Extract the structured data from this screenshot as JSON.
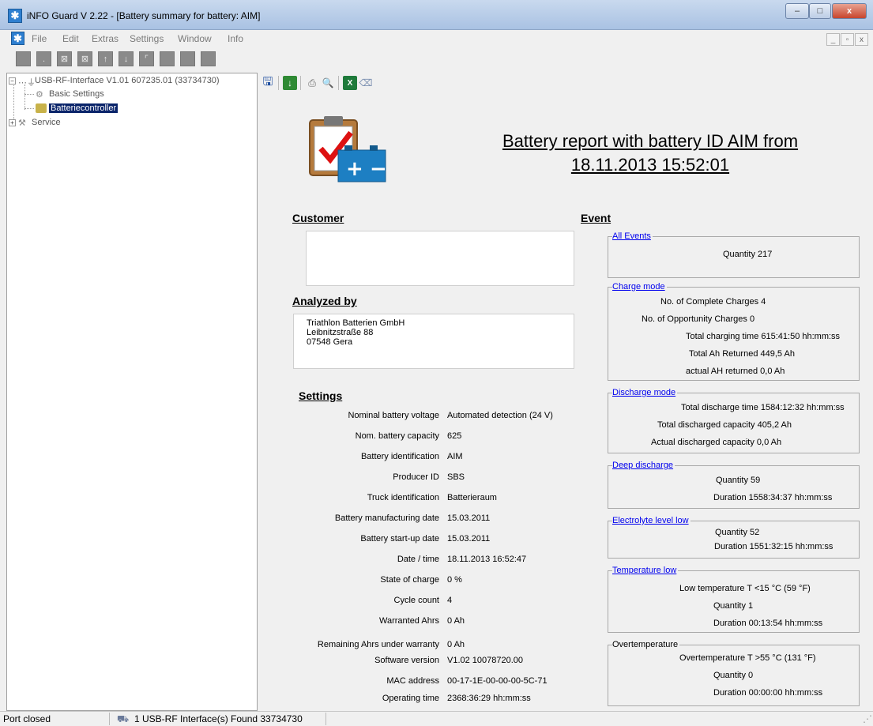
{
  "window": {
    "title": "iNFO Guard V 2.22 - [Battery summary for battery: AIM]",
    "controls": [
      "–",
      "□",
      "x"
    ]
  },
  "menu": [
    "File",
    "Edit",
    "Extras",
    "Settings",
    "Window",
    "Info"
  ],
  "tree": {
    "root": "USB-RF-Interface V1.01 607235.01 (33734730)",
    "items": [
      "Basic Settings",
      "Batteriecontroller",
      "Service"
    ]
  },
  "report": {
    "title": "Battery report with battery ID AIM from 18.11.2013 15:52:01"
  },
  "customer": {
    "heading": "Customer",
    "text": ""
  },
  "analyzed_by": {
    "heading": "Analyzed by",
    "lines": [
      "Triathlon Batterien GmbH",
      "Leibnitzstraße 88",
      "07548 Gera"
    ]
  },
  "settings": {
    "heading": "Settings",
    "rows": [
      {
        "label": "Nominal battery voltage",
        "value": "Automated detection (24 V)"
      },
      {
        "label": "Nom. battery capacity",
        "value": "625"
      },
      {
        "label": "Battery identification",
        "value": "AIM"
      },
      {
        "label": "Producer ID",
        "value": "SBS"
      },
      {
        "label": "Truck identification",
        "value": "Batterieraum"
      },
      {
        "label": "Battery manufacturing date",
        "value": "15.03.2011"
      },
      {
        "label": "Battery start-up date",
        "value": "15.03.2011"
      },
      {
        "label": "Date / time",
        "value": "18.11.2013 16:52:47"
      },
      {
        "label": "State of charge",
        "value": "0 %"
      },
      {
        "label": "Cycle count",
        "value": "4"
      },
      {
        "label": "Warranted Ahrs",
        "value": "0 Ah"
      },
      {
        "label": "Remaining Ahrs under warranty",
        "value": "0 Ah"
      },
      {
        "label": "Software version",
        "value": "V1.02 10078720.00"
      },
      {
        "label": "MAC address",
        "value": "00-17-1E-00-00-00-5C-71"
      },
      {
        "label": "Operating time",
        "value": "2368:36:29 hh:mm:ss"
      }
    ]
  },
  "event": {
    "heading": "Event",
    "groups": [
      {
        "legend": "All Events",
        "rows": [
          "Quantity  217"
        ]
      },
      {
        "legend": "Charge mode",
        "rows": [
          "No. of Complete Charges  4",
          "No. of Opportunity Charges  0",
          "Total charging time  615:41:50 hh:mm:ss",
          "Total Ah Returned  449,5 Ah",
          "actual AH returned  0,0 Ah"
        ]
      },
      {
        "legend": "Discharge mode",
        "rows": [
          "Total discharge time  1584:12:32 hh:mm:ss",
          "Total discharged capacity  405,2 Ah",
          "Actual discharged capacity  0,0 Ah"
        ]
      },
      {
        "legend": "Deep discharge",
        "rows": [
          "Quantity  59",
          "Duration  1558:34:37 hh:mm:ss"
        ]
      },
      {
        "legend": "Electrolyte level low",
        "rows": [
          "Quantity  52",
          "Duration  1551:32:15 hh:mm:ss"
        ]
      },
      {
        "legend": "Temperature low",
        "rows": [
          "Low temperature T <15 °C (59 °F)",
          "Quantity  1",
          "Duration  00:13:54 hh:mm:ss"
        ]
      },
      {
        "legend": "Overtemperature",
        "rows": [
          "Overtemperature T >55 °C (131 °F)",
          "Quantity  0",
          "Duration  00:00:00 hh:mm:ss"
        ]
      }
    ]
  },
  "status": {
    "port": "Port closed",
    "devices": "1 USB-RF Interface(s) Found 33734730"
  }
}
